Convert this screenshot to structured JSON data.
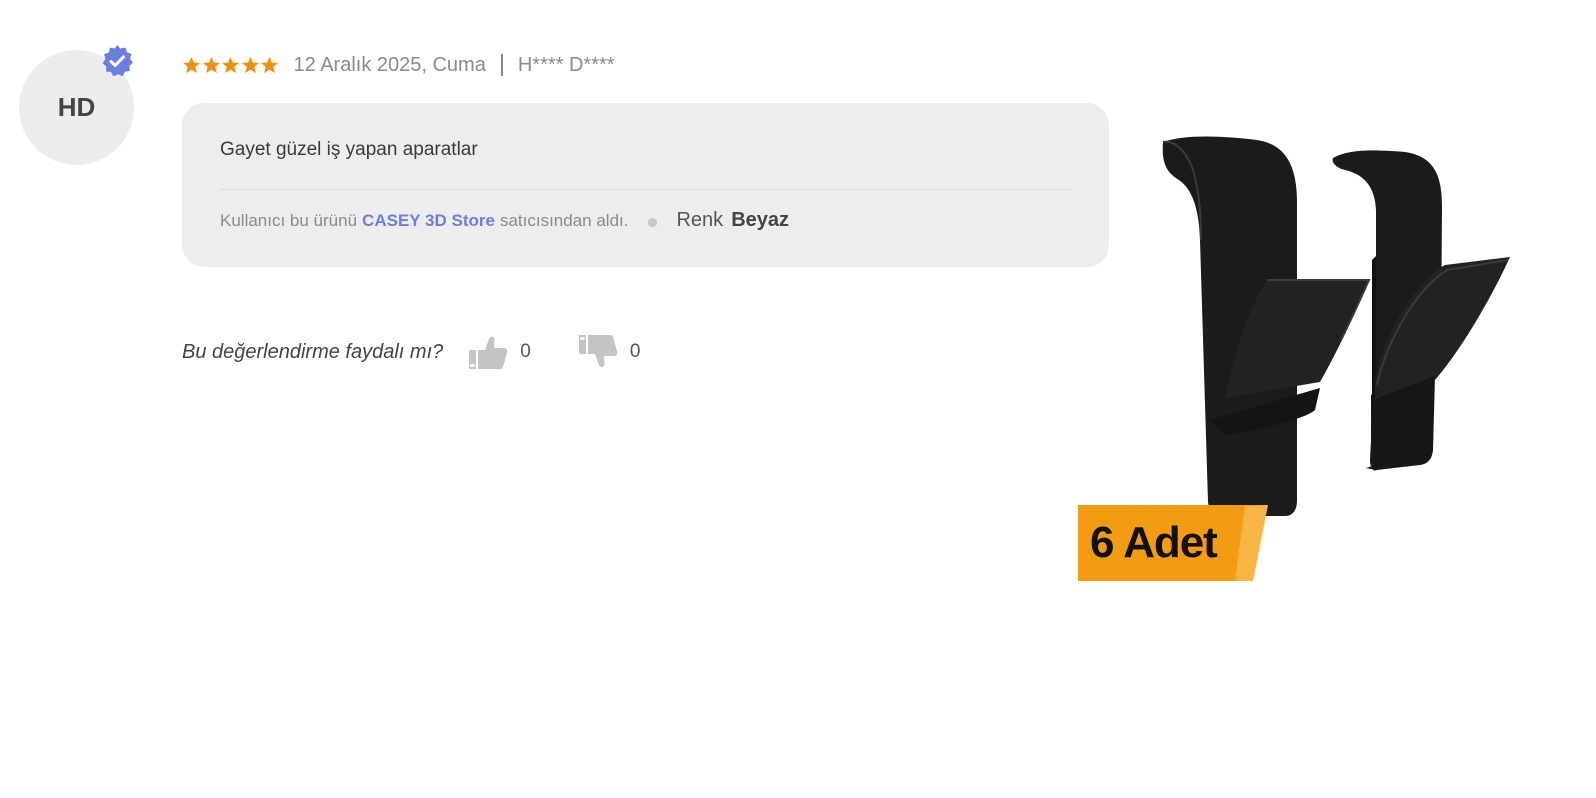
{
  "reviewer": {
    "initials": "HD",
    "verified_icon": "verified-check-icon"
  },
  "review": {
    "rating": 5,
    "max_rating": 5,
    "date": "12 Aralık 2025, Cuma",
    "author": "H**** D****",
    "comment": "Gayet güzel iş yapan aparatlar",
    "seller_prefix": "Kullanıcı bu ürünü",
    "seller_name": "CASEY 3D Store",
    "seller_suffix": "satıcısından aldı.",
    "attribute_label": "Renk",
    "attribute_value": "Beyaz"
  },
  "helpful": {
    "question": "Bu değerlendirme faydalı mı?",
    "up_icon": "thumbs-up-icon",
    "up_count": "0",
    "down_icon": "thumbs-down-icon",
    "down_count": "0"
  },
  "product_image": {
    "badge_text": "6 Adet",
    "badge_color": "#f39c12"
  },
  "colors": {
    "star": "#f0900f",
    "verified": "#6b7fe3",
    "seller_link": "#6b7fe3",
    "comment_bg": "#ededed"
  }
}
